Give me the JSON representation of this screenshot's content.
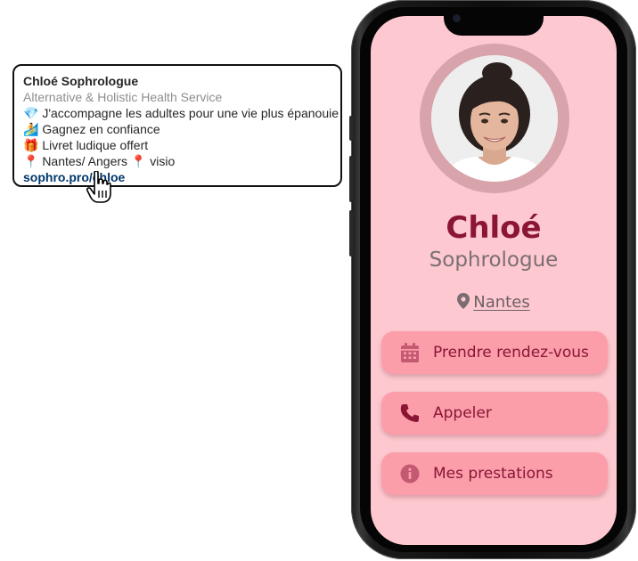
{
  "profile": {
    "name": "Chloé",
    "title": "Sophrologue",
    "location": "Nantes"
  },
  "actions": [
    {
      "label": "Prendre rendez-vous",
      "icon": "calendar-icon"
    },
    {
      "label": "Appeler",
      "icon": "phone-icon"
    },
    {
      "label": "Mes prestations",
      "icon": "info-icon"
    }
  ],
  "social_card": {
    "name": "Chloé Sophrologue",
    "category": "Alternative & Holistic Health Service",
    "lines": [
      "💎 J'accompagne les adultes pour une vie plus épanouie",
      "🏄 Gagnez en confiance",
      "🎁 Livret ludique offert",
      "📍 Nantes/ Angers 📍 visio"
    ],
    "link": "sophro.pro/chloe"
  },
  "colors": {
    "screen_bg": "#fdc8cf",
    "accent": "#8a1535",
    "button_bg": "#fb9eaa",
    "link": "#00376b"
  }
}
